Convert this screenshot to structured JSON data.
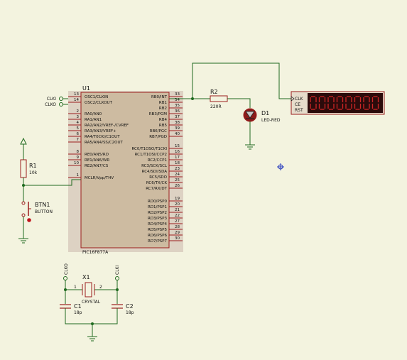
{
  "colors": {
    "background": "#f3f3df",
    "wire": "#1f6a1f",
    "outline": "#9b1c1c",
    "text": "#111111",
    "chip_body": "#cdbba1",
    "chip_shadow": "#ddd2c3",
    "led_body": "#8c1b1b",
    "segment_bg": "#2b0b0b",
    "segment_on": "#cf2626"
  },
  "mcu": {
    "ref": "U1",
    "part": "PIC16F877A",
    "left_pins": [
      {
        "num": "13",
        "name": "OSC1/CLKIN"
      },
      {
        "num": "14",
        "name": "OSC2/CLKOUT"
      },
      {
        "num": "2",
        "name": "RA0/AN0"
      },
      {
        "num": "3",
        "name": "RA1/AN1"
      },
      {
        "num": "4",
        "name": "RA2/AN2/VREF-/CVREF"
      },
      {
        "num": "5",
        "name": "RA3/AN3/VREF+"
      },
      {
        "num": "6",
        "name": "RA4/T0CKI/C1OUT"
      },
      {
        "num": "7",
        "name": "RA5/AN4/SS/C2OUT"
      },
      {
        "num": "8",
        "name": "RE0/AN5/RD"
      },
      {
        "num": "9",
        "name": "RE1/AN6/WR"
      },
      {
        "num": "10",
        "name": "RE2/AN7/CS"
      },
      {
        "num": "1",
        "name": "MCLR/Vpp/THV"
      }
    ],
    "right_pins": [
      {
        "num": "33",
        "name": "RB0/INT"
      },
      {
        "num": "34",
        "name": "RB1"
      },
      {
        "num": "35",
        "name": "RB2"
      },
      {
        "num": "36",
        "name": "RB3/PGM"
      },
      {
        "num": "37",
        "name": "RB4"
      },
      {
        "num": "38",
        "name": "RB5"
      },
      {
        "num": "39",
        "name": "RB6/PGC"
      },
      {
        "num": "40",
        "name": "RB7/PGD"
      },
      {
        "num": "15",
        "name": "RC0/T1OSO/T1CKI"
      },
      {
        "num": "16",
        "name": "RC1/T1OSI/CCP2"
      },
      {
        "num": "17",
        "name": "RC2/CCP1"
      },
      {
        "num": "18",
        "name": "RC3/SCK/SCL"
      },
      {
        "num": "23",
        "name": "RC4/SDI/SDA"
      },
      {
        "num": "24",
        "name": "RC5/SDO"
      },
      {
        "num": "25",
        "name": "RC6/TX/CK"
      },
      {
        "num": "26",
        "name": "RC7/RX/DT"
      },
      {
        "num": "19",
        "name": "RD0/PSP0"
      },
      {
        "num": "20",
        "name": "RD1/PSP1"
      },
      {
        "num": "21",
        "name": "RD2/PSP2"
      },
      {
        "num": "22",
        "name": "RD3/PSP3"
      },
      {
        "num": "27",
        "name": "RD4/PSP4"
      },
      {
        "num": "28",
        "name": "RD5/PSP5"
      },
      {
        "num": "29",
        "name": "RD6/PSP6"
      },
      {
        "num": "30",
        "name": "RD7/PSP7"
      }
    ]
  },
  "clock_labels": {
    "clki": "CLKI",
    "clko": "CLKO"
  },
  "r1": {
    "ref": "R1",
    "value": "10k"
  },
  "btn1": {
    "ref": "BTN1",
    "value": "BUTTON"
  },
  "r2": {
    "ref": "R2",
    "value": "220R"
  },
  "d1": {
    "ref": "D1",
    "value": "LED-RED"
  },
  "x1": {
    "ref": "X1",
    "value": "CRYSTAL",
    "pin1": "1",
    "pin2": "2"
  },
  "c1": {
    "ref": "C1",
    "value": "18p"
  },
  "c2": {
    "ref": "C2",
    "value": "18p"
  },
  "counter": {
    "pins": [
      "CLK",
      "CE",
      "RST"
    ],
    "digits": 8
  }
}
